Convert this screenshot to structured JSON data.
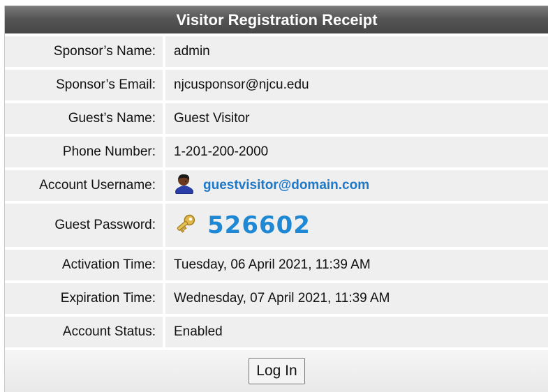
{
  "title": "Visitor Registration Receipt",
  "fields": {
    "sponsor_name": {
      "label": "Sponsor’s Name:",
      "value": "admin"
    },
    "sponsor_email": {
      "label": "Sponsor’s Email:",
      "value": "njcusponsor@njcu.edu"
    },
    "guest_name": {
      "label": "Guest’s Name:",
      "value": "Guest Visitor"
    },
    "phone": {
      "label": "Phone Number:",
      "value": "1-201-200-2000"
    },
    "username": {
      "label": "Account Username:",
      "value": "guestvisitor@domain.com",
      "icon": "user-avatar-icon",
      "color": "#1e78c8"
    },
    "password": {
      "label": "Guest Password:",
      "value": "526602",
      "icon": "key-icon",
      "color": "#1e88d4"
    },
    "activation": {
      "label": "Activation Time:",
      "value": "Tuesday, 06 April 2021, 11:39 AM"
    },
    "expiration": {
      "label": "Expiration Time:",
      "value": "Wednesday, 07 April 2021, 11:39 AM"
    },
    "status": {
      "label": "Account Status:",
      "value": "Enabled"
    }
  },
  "login_button": "Log In"
}
